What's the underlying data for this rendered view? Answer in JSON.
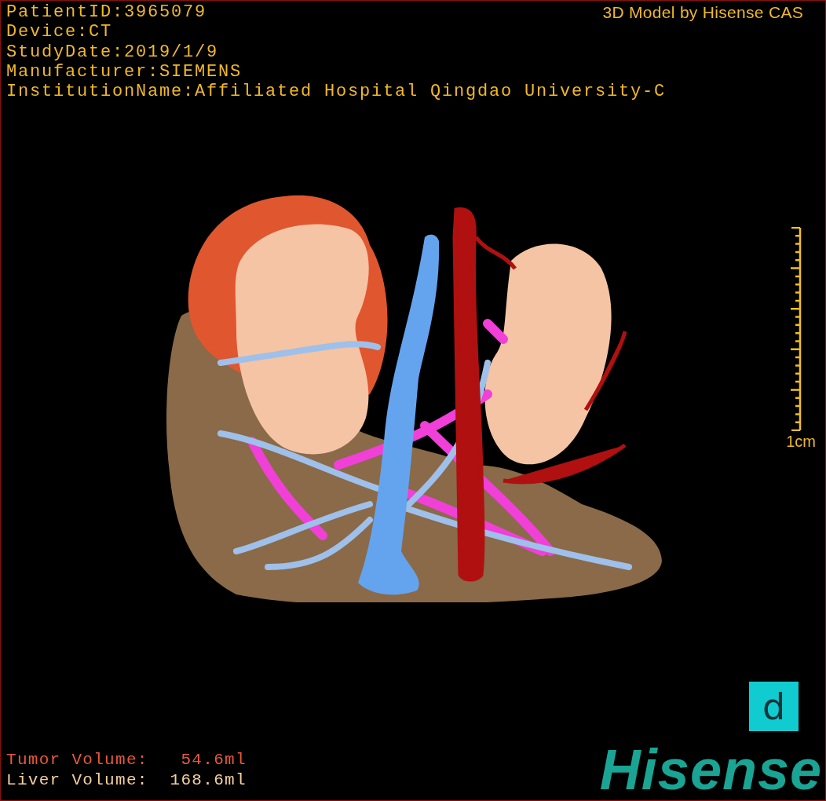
{
  "study_info": [
    {
      "label": "PatientID:",
      "value": "3965079"
    },
    {
      "label": "Device:",
      "value": "CT"
    },
    {
      "label": "StudyDate:",
      "value": "2019/1/9"
    },
    {
      "label": "Manufacturer:",
      "value": "SIEMENS"
    },
    {
      "label": "InstitutionName:",
      "value": "Affiliated Hospital Qingdao University-C"
    }
  ],
  "title": "3D Model by Hisense CAS",
  "scale": {
    "label": "1cm"
  },
  "volumes": [
    {
      "label": "Tumor Volume:",
      "value": "54.6ml",
      "color": "#e8583c"
    },
    {
      "label": "Liver Volume:",
      "value": "168.6ml",
      "color": "#f4d0a0"
    }
  ],
  "badge": {
    "letter": "d"
  },
  "logo": {
    "text": "Hisense"
  }
}
